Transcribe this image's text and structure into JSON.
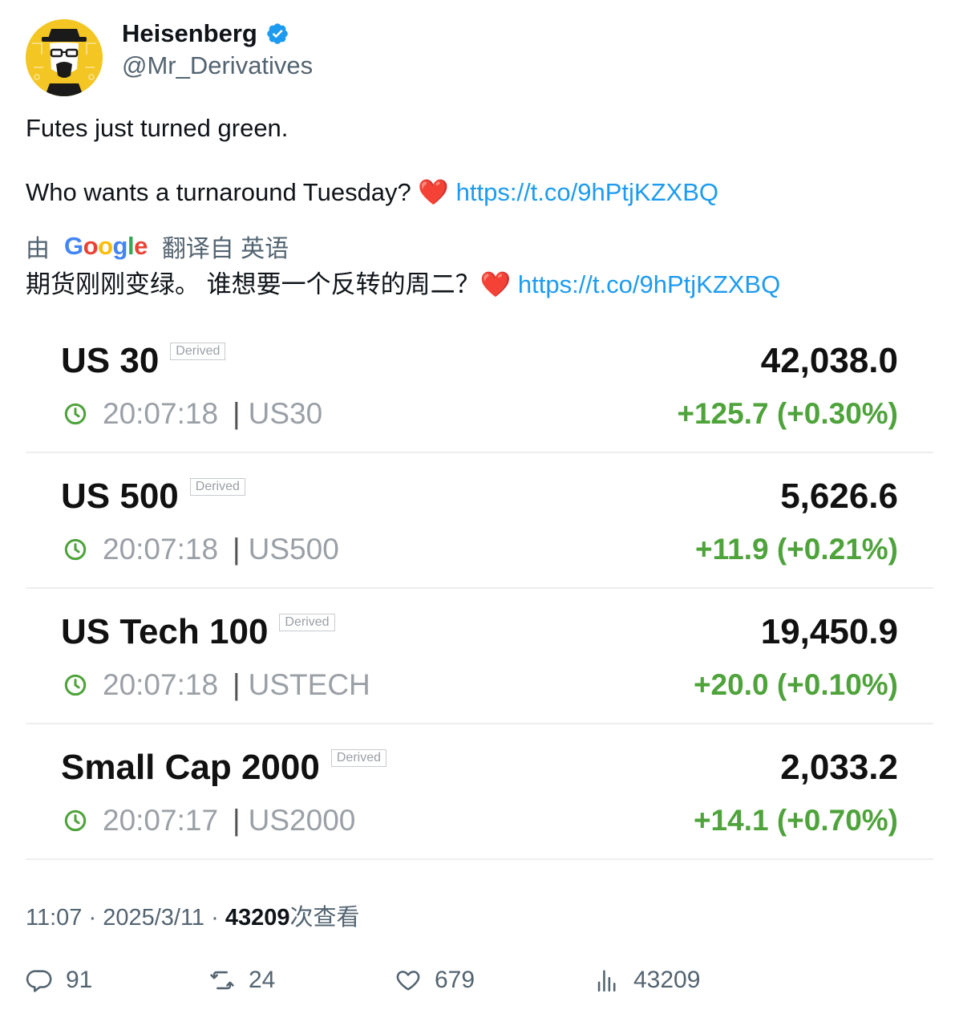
{
  "user": {
    "display_name": "Heisenberg",
    "handle": "@Mr_Derivatives",
    "verified": true,
    "avatar_icon": "heisenberg-avatar-icon"
  },
  "tweet": {
    "line1": "Futes just turned green.",
    "line2_text": "Who wants a turnaround Tuesday? ",
    "heart": "❤️",
    "link": "https://t.co/9hPtjKZXBQ"
  },
  "translation": {
    "prefix": "由",
    "brand": "Google",
    "suffix": "翻译自 英语",
    "text": "期货刚刚变绿。 谁想要一个反转的周二？",
    "heart": "❤️",
    "link": "https://t.co/9hPtjKZXBQ"
  },
  "quotes": [
    {
      "name": "US 30",
      "badge": "Derived",
      "price": "42,038.0",
      "time": "20:07:18",
      "symbol": "US30",
      "change": "+125.7 (+0.30%)"
    },
    {
      "name": "US 500",
      "badge": "Derived",
      "price": "5,626.6",
      "time": "20:07:18",
      "symbol": "US500",
      "change": "+11.9 (+0.21%)"
    },
    {
      "name": "US Tech 100",
      "badge": "Derived",
      "price": "19,450.9",
      "time": "20:07:18",
      "symbol": "USTECH",
      "change": "+20.0 (+0.10%)"
    },
    {
      "name": "Small Cap 2000",
      "badge": "Derived",
      "price": "2,033.2",
      "time": "20:07:17",
      "symbol": "US2000",
      "change": "+14.1 (+0.70%)"
    }
  ],
  "meta": {
    "time": "11:07",
    "date": "2025/3/11",
    "views_count": "43209",
    "views_label": "次查看"
  },
  "actions": {
    "replies": "91",
    "retweets": "24",
    "likes": "679",
    "views": "43209"
  },
  "colors": {
    "link": "#1d9bf0",
    "positive": "#4ea33b",
    "verified": "#1d9bf0",
    "muted": "#536471"
  }
}
